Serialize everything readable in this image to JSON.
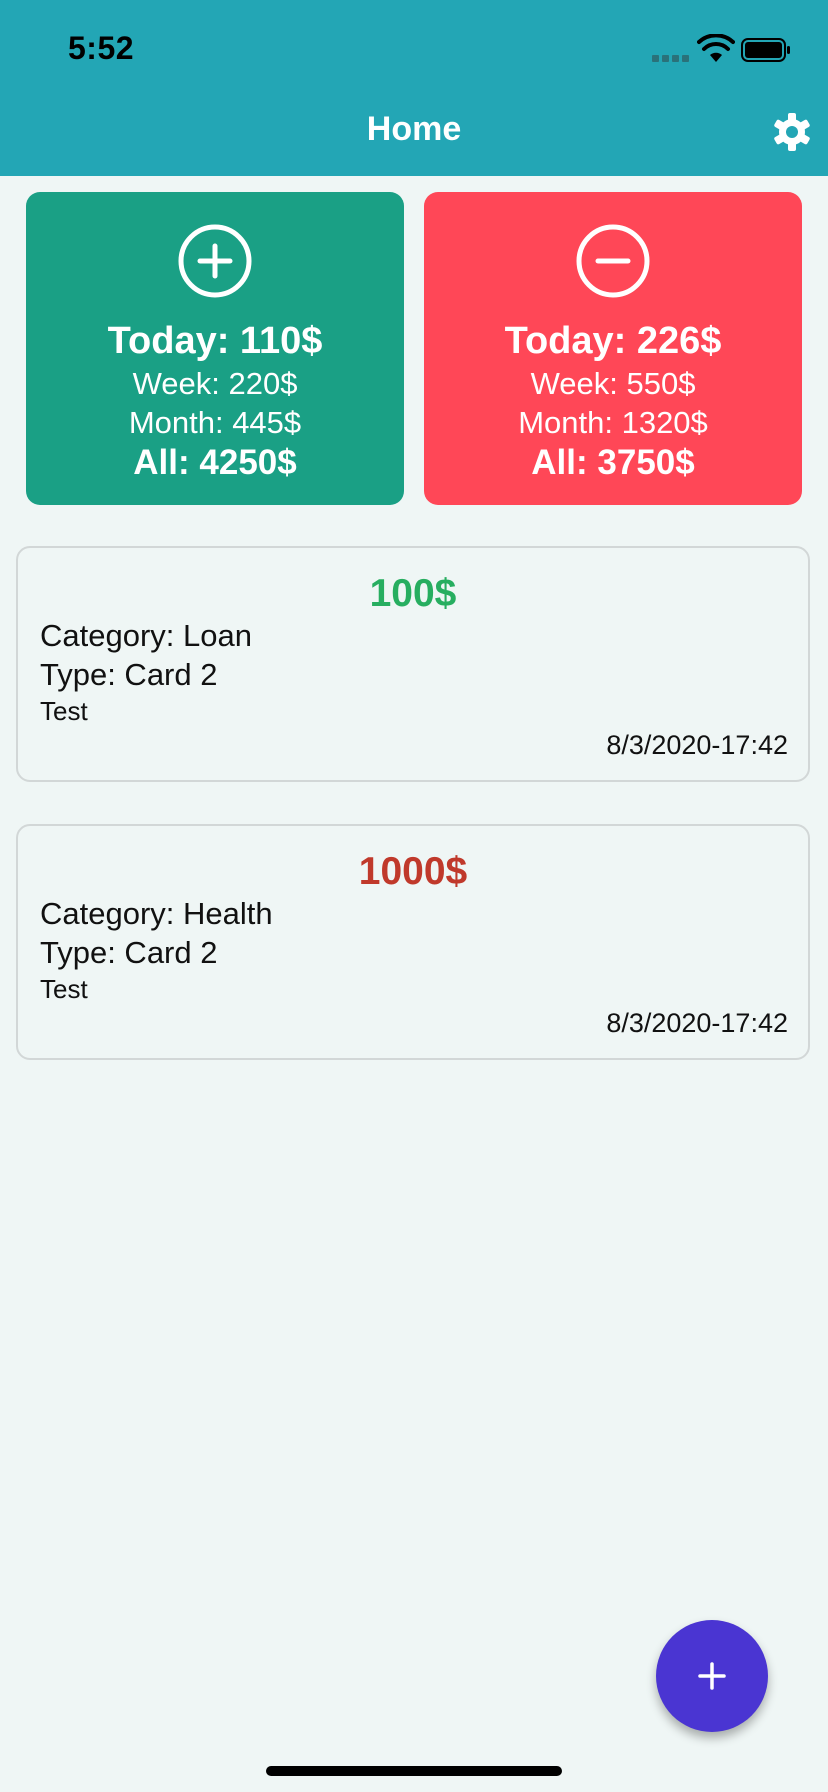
{
  "status_bar": {
    "time": "5:52"
  },
  "header": {
    "title": "Home",
    "settings_icon": "gear-icon"
  },
  "summary": {
    "income": {
      "icon": "plus-circle-icon",
      "color": "#1aa085",
      "today": "Today: 110$",
      "week": "Week: 220$",
      "month": "Month: 445$",
      "all": "All: 4250$"
    },
    "expense": {
      "icon": "minus-circle-icon",
      "color": "#ff4757",
      "today": "Today: 226$",
      "week": "Week: 550$",
      "month": "Month: 1320$",
      "all": "All: 3750$"
    }
  },
  "transactions": [
    {
      "amount": "100$",
      "amount_color": "#27ae60",
      "category": "Category: Loan",
      "type": "Type: Card 2",
      "note": "Test",
      "date": "8/3/2020-17:42"
    },
    {
      "amount": "1000$",
      "amount_color": "#c0392b",
      "category": "Category: Health",
      "type": "Type: Card 2",
      "note": "Test",
      "date": "8/3/2020-17:42"
    }
  ],
  "fab": {
    "icon": "plus-icon",
    "color": "#4a35d2"
  },
  "colors": {
    "header": "#23a6b5",
    "background": "#eff6f5"
  }
}
